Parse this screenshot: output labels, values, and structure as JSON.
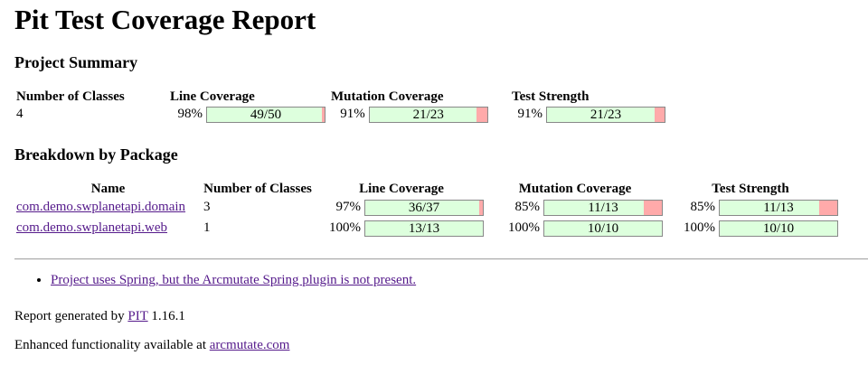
{
  "title": "Pit Test Coverage Report",
  "project_summary": {
    "heading": "Project Summary",
    "headers": [
      "Number of Classes",
      "Line Coverage",
      "Mutation Coverage",
      "Test Strength"
    ],
    "classes": "4",
    "line": {
      "pct": "98%",
      "label": "49/50",
      "fraction": 0.98
    },
    "mutation": {
      "pct": "91%",
      "label": "21/23",
      "fraction": 0.913
    },
    "strength": {
      "pct": "91%",
      "label": "21/23",
      "fraction": 0.913
    }
  },
  "breakdown": {
    "heading": "Breakdown by Package",
    "headers": [
      "Name",
      "Number of Classes",
      "Line Coverage",
      "Mutation Coverage",
      "Test Strength"
    ],
    "rows": [
      {
        "name": "com.demo.swplanetapi.domain",
        "classes": "3",
        "line": {
          "pct": "97%",
          "label": "36/37",
          "fraction": 0.973
        },
        "mutation": {
          "pct": "85%",
          "label": "11/13",
          "fraction": 0.846
        },
        "strength": {
          "pct": "85%",
          "label": "11/13",
          "fraction": 0.846
        }
      },
      {
        "name": "com.demo.swplanetapi.web",
        "classes": "1",
        "line": {
          "pct": "100%",
          "label": "13/13",
          "fraction": 1.0
        },
        "mutation": {
          "pct": "100%",
          "label": "10/10",
          "fraction": 1.0
        },
        "strength": {
          "pct": "100%",
          "label": "10/10",
          "fraction": 1.0
        }
      }
    ]
  },
  "notes": [
    "Project uses Spring, but the Arcmutate Spring plugin is not present."
  ],
  "footer": {
    "generated_prefix": "Report generated by ",
    "generated_link": "PIT",
    "generated_version": " 1.16.1",
    "enhanced_prefix": "Enhanced functionality available at ",
    "enhanced_link": "arcmutate.com"
  },
  "colors": {
    "covered": "#ddffdd",
    "uncovered": "#ffaaaa",
    "link": "#551a8b"
  }
}
